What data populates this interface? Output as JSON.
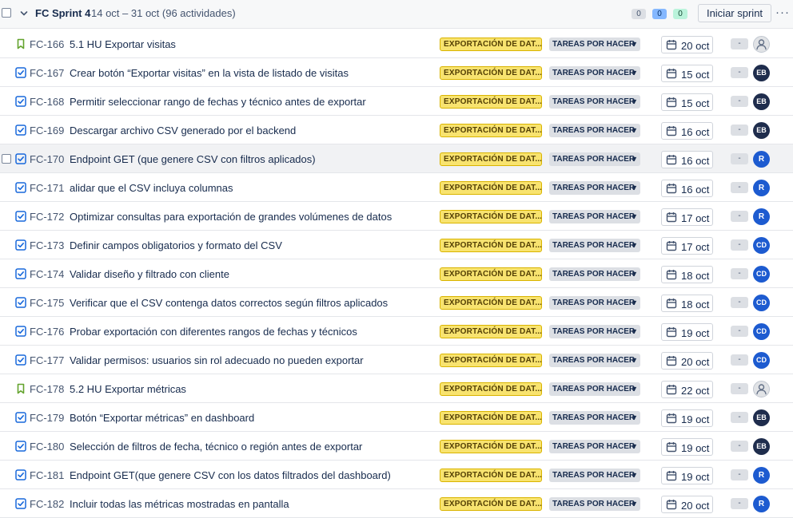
{
  "sprint": {
    "title": "FC Sprint 4",
    "meta": "14 oct – 31 oct (96 actividades)",
    "counts": {
      "todo": "0",
      "in_progress": "0",
      "done": "0"
    },
    "start_label": "Iniciar sprint",
    "more_label": "···"
  },
  "colors": {
    "epic_bg": "#f8e36f",
    "status_bg": "#dcdfe4",
    "task_icon": "#1868db",
    "story_icon": "#63a32d",
    "avatar_dark": "#1f2d4d",
    "avatar_blue": "#1d5bd0"
  },
  "rows": [
    {
      "type": "story",
      "key": "FC-166",
      "summary": "5.1 HU Exportar visitas",
      "epic": "EXPORTACIÓN DE DAT...",
      "status": "TAREAS POR HACER",
      "date": "20 oct",
      "estimate": "-",
      "assignee": ""
    },
    {
      "type": "task",
      "key": "FC-167",
      "summary": "Crear botón “Exportar visitas” en la vista de listado de visitas",
      "epic": "EXPORTACIÓN DE DAT...",
      "status": "TAREAS POR HACER",
      "date": "15 oct",
      "estimate": "-",
      "assignee": "EB"
    },
    {
      "type": "task",
      "key": "FC-168",
      "summary": "Permitir seleccionar rango de fechas y técnico antes de exportar",
      "epic": "EXPORTACIÓN DE DAT...",
      "status": "TAREAS POR HACER",
      "date": "15 oct",
      "estimate": "-",
      "assignee": "EB"
    },
    {
      "type": "task",
      "key": "FC-169",
      "summary": "Descargar archivo CSV generado por el backend",
      "epic": "EXPORTACIÓN DE DAT...",
      "status": "TAREAS POR HACER",
      "date": "16 oct",
      "estimate": "-",
      "assignee": "EB"
    },
    {
      "type": "task",
      "key": "FC-170",
      "summary": "Endpoint GET (que genere CSV con filtros aplicados)",
      "epic": "EXPORTACIÓN DE DAT...",
      "status": "TAREAS POR HACER",
      "date": "16 oct",
      "estimate": "-",
      "assignee": "R"
    },
    {
      "type": "task",
      "key": "FC-171",
      "summary": "alidar que el CSV incluya columnas",
      "epic": "EXPORTACIÓN DE DAT...",
      "status": "TAREAS POR HACER",
      "date": "16 oct",
      "estimate": "-",
      "assignee": "R"
    },
    {
      "type": "task",
      "key": "FC-172",
      "summary": "Optimizar consultas para exportación de grandes volúmenes de datos",
      "epic": "EXPORTACIÓN DE DAT...",
      "status": "TAREAS POR HACER",
      "date": "17 oct",
      "estimate": "-",
      "assignee": "R"
    },
    {
      "type": "task",
      "key": "FC-173",
      "summary": "Definir campos obligatorios y formato del CSV",
      "epic": "EXPORTACIÓN DE DAT...",
      "status": "TAREAS POR HACER",
      "date": "17 oct",
      "estimate": "-",
      "assignee": "CD"
    },
    {
      "type": "task",
      "key": "FC-174",
      "summary": "Validar diseño y filtrado con cliente",
      "epic": "EXPORTACIÓN DE DAT...",
      "status": "TAREAS POR HACER",
      "date": "18 oct",
      "estimate": "-",
      "assignee": "CD"
    },
    {
      "type": "task",
      "key": "FC-175",
      "summary": "Verificar que el CSV contenga datos correctos según filtros aplicados",
      "epic": "EXPORTACIÓN DE DAT...",
      "status": "TAREAS POR HACER",
      "date": "18 oct",
      "estimate": "-",
      "assignee": "CD"
    },
    {
      "type": "task",
      "key": "FC-176",
      "summary": "Probar exportación con diferentes rangos de fechas y técnicos",
      "epic": "EXPORTACIÓN DE DAT...",
      "status": "TAREAS POR HACER",
      "date": "19 oct",
      "estimate": "-",
      "assignee": "CD"
    },
    {
      "type": "task",
      "key": "FC-177",
      "summary": "Validar permisos: usuarios sin rol adecuado no pueden exportar",
      "epic": "EXPORTACIÓN DE DAT...",
      "status": "TAREAS POR HACER",
      "date": "20 oct",
      "estimate": "-",
      "assignee": "CD"
    },
    {
      "type": "story",
      "key": "FC-178",
      "summary": "5.2 HU Exportar métricas",
      "epic": "EXPORTACIÓN DE DAT...",
      "status": "TAREAS POR HACER",
      "date": "22 oct",
      "estimate": "-",
      "assignee": ""
    },
    {
      "type": "task",
      "key": "FC-179",
      "summary": "Botón “Exportar métricas” en dashboard",
      "epic": "EXPORTACIÓN DE DAT...",
      "status": "TAREAS POR HACER",
      "date": "19 oct",
      "estimate": "-",
      "assignee": "EB"
    },
    {
      "type": "task",
      "key": "FC-180",
      "summary": "Selección de filtros de fecha, técnico o región antes de exportar",
      "epic": "EXPORTACIÓN DE DAT...",
      "status": "TAREAS POR HACER",
      "date": "19 oct",
      "estimate": "-",
      "assignee": "EB"
    },
    {
      "type": "task",
      "key": "FC-181",
      "summary": "Endpoint GET(que genere CSV con los datos filtrados del dashboard)",
      "epic": "EXPORTACIÓN DE DAT...",
      "status": "TAREAS POR HACER",
      "date": "19 oct",
      "estimate": "-",
      "assignee": "R"
    },
    {
      "type": "task",
      "key": "FC-182",
      "summary": "Incluir todas las métricas mostradas en pantalla",
      "epic": "EXPORTACIÓN DE DAT...",
      "status": "TAREAS POR HACER",
      "date": "20 oct",
      "estimate": "-",
      "assignee": "R"
    }
  ]
}
